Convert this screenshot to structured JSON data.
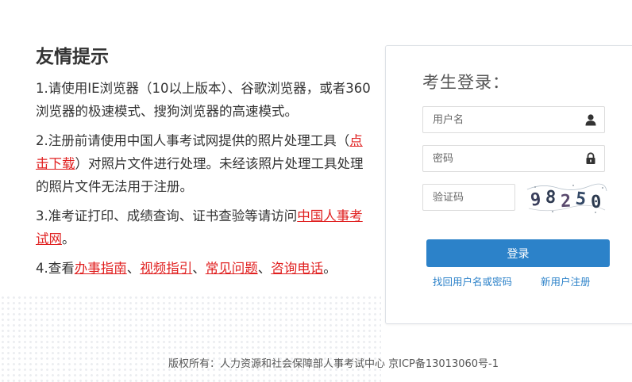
{
  "tips": {
    "title": "友情提示",
    "items": [
      {
        "segments": [
          {
            "text": "1.请使用IE浏览器（10以上版本）、谷歌浏览器，或者360浏览器的极速模式、搜狗浏览器的高速模式。",
            "link": false
          }
        ]
      },
      {
        "segments": [
          {
            "text": "2.注册前请使用中国人事考试网提供的照片处理工具（",
            "link": false
          },
          {
            "text": "点击下载",
            "link": true
          },
          {
            "text": "）对照片文件进行处理。未经该照片处理工具处理的照片文件无法用于注册。",
            "link": false
          }
        ]
      },
      {
        "segments": [
          {
            "text": "3.准考证打印、成绩查询、证书查验等请访问",
            "link": false
          },
          {
            "text": "中国人事考试网",
            "link": true
          },
          {
            "text": "。",
            "link": false
          }
        ]
      },
      {
        "segments": [
          {
            "text": "4.查看",
            "link": false
          },
          {
            "text": "办事指南",
            "link": true
          },
          {
            "text": "、",
            "link": false
          },
          {
            "text": "视频指引",
            "link": true
          },
          {
            "text": "、",
            "link": false
          },
          {
            "text": "常见问题",
            "link": true
          },
          {
            "text": "、",
            "link": false
          },
          {
            "text": "咨询电话",
            "link": true
          },
          {
            "text": "。",
            "link": false
          }
        ]
      }
    ],
    "link_color": "#e02020"
  },
  "login": {
    "title": "考生登录：",
    "username_placeholder": "用户名",
    "password_placeholder": "密码",
    "captcha_placeholder": "验证码",
    "captcha_text": "98250",
    "submit_label": "登录",
    "forgot_label": "找回用户名或密码",
    "register_label": "新用户注册",
    "accent_color": "#2c82c9",
    "username_icon": "user-icon",
    "password_icon": "lock-icon"
  },
  "footer": {
    "text": "版权所有：人力资源和社会保障部人事考试中心 京ICP备13013060号-1"
  }
}
